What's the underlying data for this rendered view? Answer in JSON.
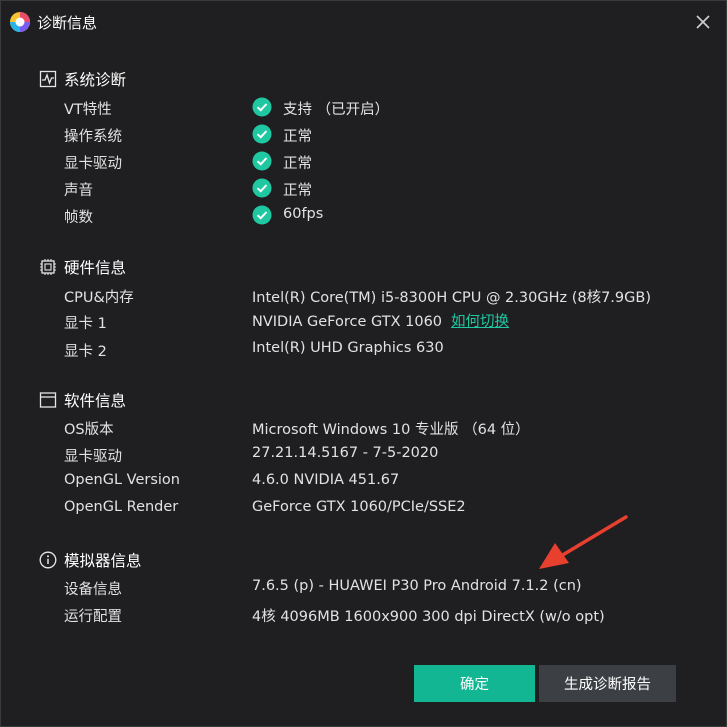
{
  "window": {
    "title": "诊断信息"
  },
  "system": {
    "title": "系统诊断",
    "rows": [
      {
        "label": "VT特性",
        "value": "支持 （已开启）"
      },
      {
        "label": "操作系统",
        "value": "正常"
      },
      {
        "label": "显卡驱动",
        "value": "正常"
      },
      {
        "label": "声音",
        "value": "正常"
      },
      {
        "label": "帧数",
        "value": "60fps"
      }
    ]
  },
  "hardware": {
    "title": "硬件信息",
    "rows": [
      {
        "label": "CPU&内存",
        "value": "Intel(R) Core(TM) i5-8300H CPU @ 2.30GHz (8核7.9GB)"
      },
      {
        "label": "显卡 1",
        "value": "NVIDIA GeForce GTX 1060",
        "link": "如何切换"
      },
      {
        "label": "显卡 2",
        "value": "Intel(R) UHD Graphics 630"
      }
    ]
  },
  "software": {
    "title": "软件信息",
    "rows": [
      {
        "label": "OS版本",
        "value": "Microsoft Windows 10 专业版 （64 位）"
      },
      {
        "label": "显卡驱动",
        "value": "27.21.14.5167 - 7-5-2020"
      },
      {
        "label": "OpenGL Version",
        "value": "4.6.0 NVIDIA 451.67"
      },
      {
        "label": "OpenGL Render",
        "value": "GeForce GTX 1060/PCIe/SSE2"
      }
    ]
  },
  "emulator": {
    "title": "模拟器信息",
    "rows": [
      {
        "label": "设备信息",
        "value": "7.6.5 (p) - HUAWEI P30 Pro Android 7.1.2 (cn)"
      },
      {
        "label": "运行配置",
        "value": "4核 4096MB 1600x900 300 dpi DirectX (w/o opt)"
      }
    ]
  },
  "buttons": {
    "ok": "确定",
    "report": "生成诊断报告"
  },
  "colors": {
    "accent": "#12b692",
    "check": "#1fc8a1",
    "arrow": "#e8402f",
    "background": "#1f1f21"
  },
  "icons": {
    "app": "app-logo-icon",
    "close": "close-icon",
    "system": "pulse-monitor-icon",
    "hardware": "chip-icon",
    "software": "window-icon",
    "emulator": "info-circle-icon",
    "check": "check-circle-icon"
  }
}
